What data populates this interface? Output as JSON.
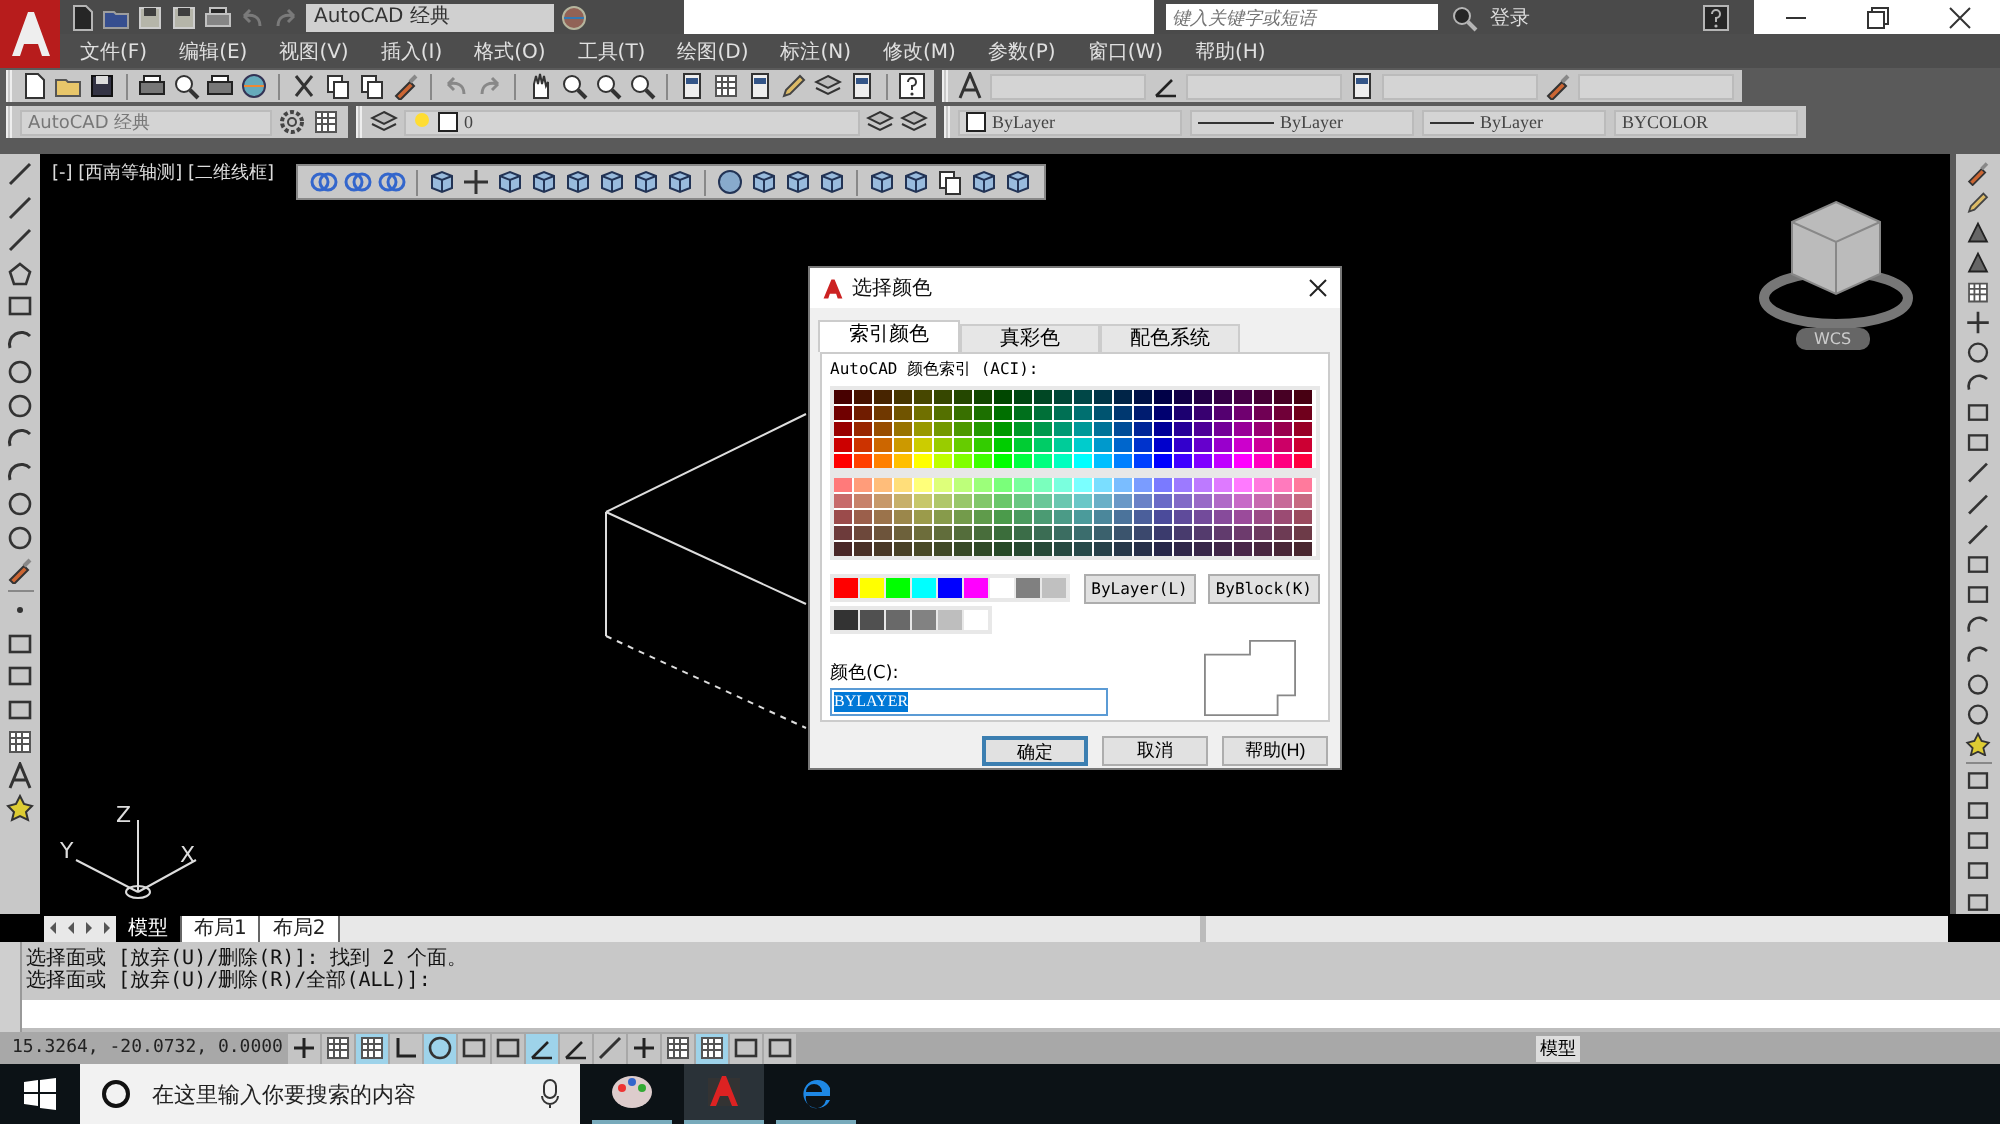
{
  "title_bar": {
    "workspace": "AutoCAD 经典",
    "search_placeholder": "键入关键字或短语",
    "login": "登录"
  },
  "menu": [
    "文件(F)",
    "编辑(E)",
    "视图(V)",
    "插入(I)",
    "格式(O)",
    "工具(T)",
    "绘图(D)",
    "标注(N)",
    "修改(M)",
    "参数(P)",
    "窗口(W)",
    "帮助(H)"
  ],
  "properties_bar": {
    "workspace": "AutoCAD 经典",
    "layer": "0",
    "color_setting": "ByLayer",
    "linetype": "ByLayer",
    "lineweight": "ByLayer",
    "plot_style": "BYCOLOR"
  },
  "viewport_label": "[-] [西南等轴测] [二维线框]",
  "viewcube": {
    "label": "WCS"
  },
  "ucs": {
    "x": "X",
    "y": "Y",
    "z": "Z"
  },
  "dialog": {
    "title": "选择颜色",
    "tabs": [
      {
        "label": "索引颜色",
        "selected": true
      },
      {
        "label": "真彩色",
        "selected": false
      },
      {
        "label": "配色系统",
        "selected": false
      }
    ],
    "aci_label": "AutoCAD 颜色索引 (ACI):",
    "bylayer_button": "ByLayer(L)",
    "byblock_button": "ByBlock(K)",
    "color_label": "颜色(C):",
    "color_value": "BYLAYER",
    "buttons": [
      {
        "label": "确定",
        "default": true
      },
      {
        "label": "取消",
        "default": false
      },
      {
        "label": "帮助(H)",
        "default": false
      }
    ]
  },
  "layout_tabs": [
    {
      "label": "模型",
      "selected": true
    },
    {
      "label": "布局1",
      "selected": false
    },
    {
      "label": "布局2",
      "selected": false
    }
  ],
  "command_lines": [
    "选择面或 [放弃(U)/删除(R)]: 找到 2 个面。",
    "选择面或 [放弃(U)/删除(R)/全部(ALL)]:"
  ],
  "status_bar": {
    "coordinates": "15.3264, -20.0732, 0.0000",
    "model_label": "模型",
    "toggles": [
      {
        "on": false
      },
      {
        "on": false
      },
      {
        "on": true
      },
      {
        "on": false
      },
      {
        "on": true
      },
      {
        "on": false
      },
      {
        "on": false
      },
      {
        "on": true
      },
      {
        "on": false
      },
      {
        "on": false
      },
      {
        "on": false
      },
      {
        "on": false
      },
      {
        "on": true
      },
      {
        "on": false
      },
      {
        "on": false
      }
    ]
  },
  "taskbar": {
    "search_placeholder": "在这里输入你要搜索的内容"
  }
}
